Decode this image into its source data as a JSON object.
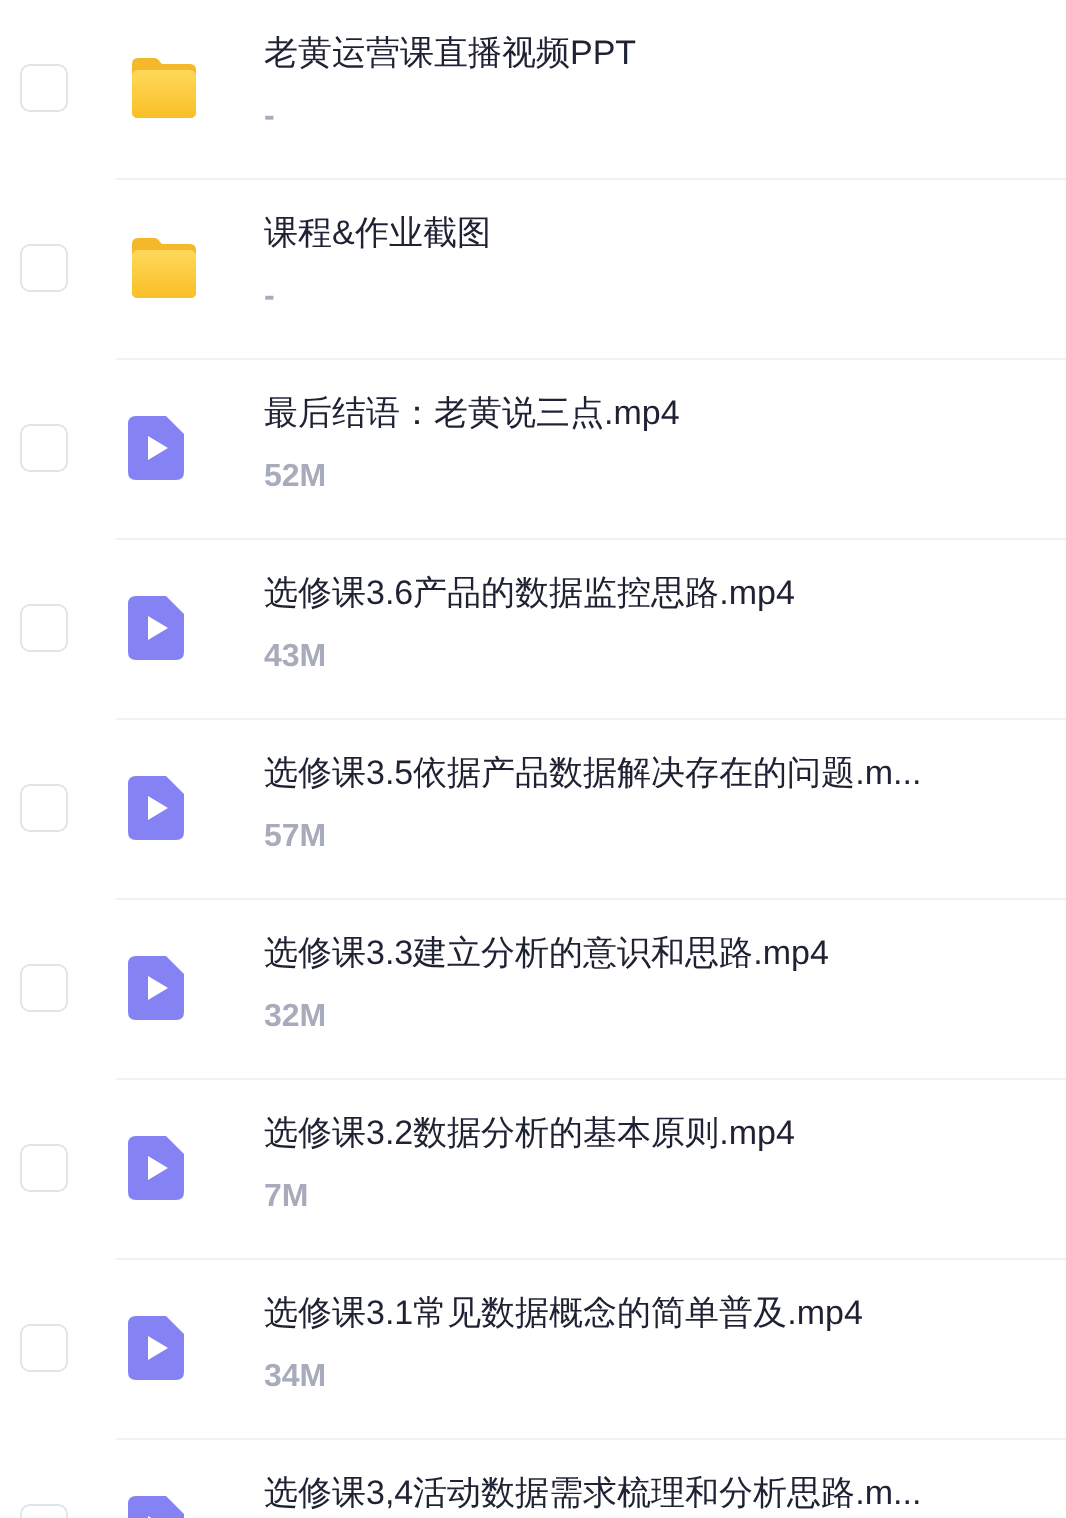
{
  "files": [
    {
      "kind": "folder",
      "name": "老黄运营课直播视频PPT",
      "size": "-",
      "checked": false
    },
    {
      "kind": "folder",
      "name": "课程&作业截图",
      "size": "-",
      "checked": false
    },
    {
      "kind": "video",
      "name": "最后结语：老黄说三点.mp4",
      "size": "52M",
      "checked": false
    },
    {
      "kind": "video",
      "name": "选修课3.6产品的数据监控思路.mp4",
      "size": "43M",
      "checked": false
    },
    {
      "kind": "video",
      "name": "选修课3.5依据产品数据解决存在的问题.m...",
      "size": "57M",
      "checked": false
    },
    {
      "kind": "video",
      "name": "选修课3.3建立分析的意识和思路.mp4",
      "size": "32M",
      "checked": false
    },
    {
      "kind": "video",
      "name": "选修课3.2数据分析的基本原则.mp4",
      "size": "7M",
      "checked": false
    },
    {
      "kind": "video",
      "name": "选修课3.1常见数据概念的简单普及.mp4",
      "size": "34M",
      "checked": false
    },
    {
      "kind": "video",
      "name": "选修课3,4活动数据需求梳理和分析思路.m...",
      "checked": false
    }
  ]
}
